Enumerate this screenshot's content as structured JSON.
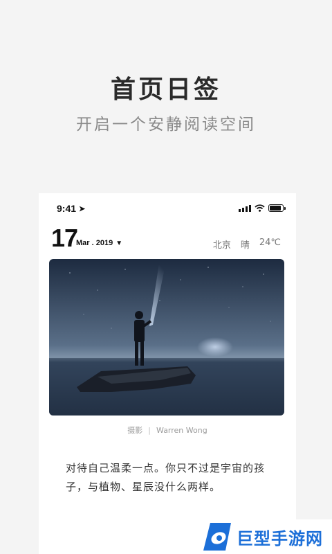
{
  "hero": {
    "title": "首页日签",
    "subtitle": "开启一个安静阅读空间"
  },
  "status_bar": {
    "time": "9:41",
    "location_icon": "location-arrow-icon",
    "signal_icon": "cellular-signal-icon",
    "wifi_icon": "wifi-icon",
    "battery_icon": "battery-icon",
    "battery_level": 0.9
  },
  "date": {
    "day": "17",
    "month_year": "Mar . 2019",
    "dropdown_icon": "triangle-down-icon"
  },
  "weather": {
    "city": "北京",
    "condition": "晴",
    "temperature": "24℃"
  },
  "photo": {
    "credit_label": "摄影",
    "credit_separator": "|",
    "photographer": "Warren Wong"
  },
  "quote": {
    "text": "对待自己温柔一点。你只不过是宇宙的孩子，与植物、星辰没什么两样。"
  },
  "watermark": {
    "text": "巨型手游网",
    "color": "#1c6fd8"
  }
}
